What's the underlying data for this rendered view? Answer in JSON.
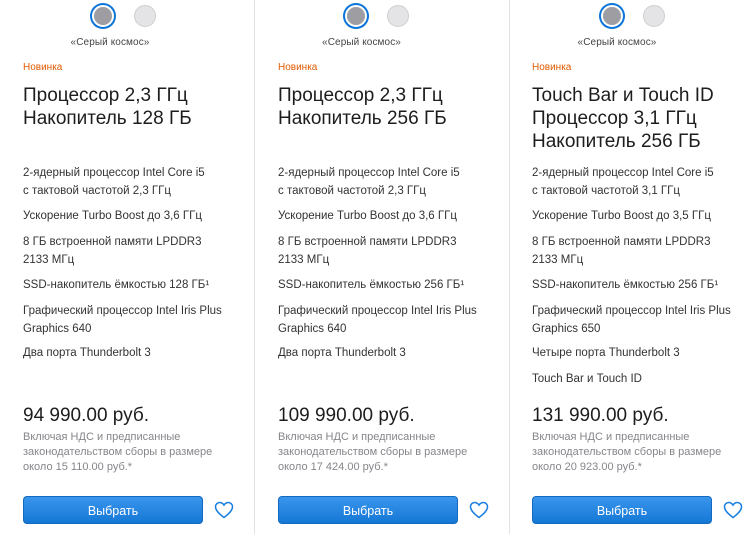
{
  "colors": {
    "accent": "#1a7fdf",
    "badge": "#e25a00",
    "space_gray": "#9e9ea2",
    "silver": "#e4e4e6"
  },
  "products": [
    {
      "color_name": "«Серый космос»",
      "badge": "Новинка",
      "title": [
        "Процессор 2,3 ГГц",
        "Накопитель 128 ГБ"
      ],
      "specs": [
        [
          "2-ядерный процессор Intel Core i5",
          "с тактовой частотой 2,3 ГГц"
        ],
        [
          "Ускорение Turbo Boost до 3,6 ГГц"
        ],
        [
          "8 ГБ встроенной памяти LPDDR3",
          "2133 МГц"
        ],
        [
          "SSD-накопитель ёмкостью 128 ГБ¹"
        ],
        [
          "Графический процессор Intel Iris Plus",
          "Graphics 640"
        ],
        [
          "Два порта Thunderbolt 3"
        ]
      ],
      "price": "94 990.00 руб.",
      "tax_note": [
        "Включая НДС и предписанные",
        "законодательством сборы в размере",
        "около 15 110.00 руб.*"
      ],
      "select_label": "Выбрать"
    },
    {
      "color_name": "«Серый космос»",
      "badge": "Новинка",
      "title": [
        "Процессор 2,3 ГГц",
        "Накопитель 256 ГБ"
      ],
      "specs": [
        [
          "2-ядерный процессор Intel Core i5",
          "с тактовой частотой 2,3 ГГц"
        ],
        [
          "Ускорение Turbo Boost до 3,6 ГГц"
        ],
        [
          "8 ГБ встроенной памяти LPDDR3",
          "2133 МГц"
        ],
        [
          "SSD-накопитель ёмкостью 256 ГБ¹"
        ],
        [
          "Графический процессор Intel Iris Plus",
          "Graphics 640"
        ],
        [
          "Два порта Thunderbolt 3"
        ]
      ],
      "price": "109 990.00 руб.",
      "tax_note": [
        "Включая НДС и предписанные",
        "законодательством сборы в размере",
        "около 17 424.00 руб.*"
      ],
      "select_label": "Выбрать"
    },
    {
      "color_name": "«Серый космос»",
      "badge": "Новинка",
      "title": [
        "Touch Bar и Touch ID",
        "Процессор 3,1 ГГц",
        "Накопитель 256 ГБ"
      ],
      "specs": [
        [
          "2-ядерный процессор Intel Core i5",
          "с тактовой частотой 3,1 ГГц"
        ],
        [
          "Ускорение Turbo Boost до 3,5 ГГц"
        ],
        [
          "8 ГБ встроенной памяти LPDDR3",
          "2133 МГц"
        ],
        [
          "SSD-накопитель ёмкостью 256 ГБ¹"
        ],
        [
          "Графический процессор Intel Iris Plus",
          "Graphics 650"
        ],
        [
          "Четыре порта Thunderbolt 3"
        ],
        [
          "Touch Bar и Touch ID"
        ]
      ],
      "price": "131 990.00 руб.",
      "tax_note": [
        "Включая НДС и предписанные",
        "законодательством сборы в размере",
        "около 20 923.00 руб.*"
      ],
      "select_label": "Выбрать"
    }
  ]
}
